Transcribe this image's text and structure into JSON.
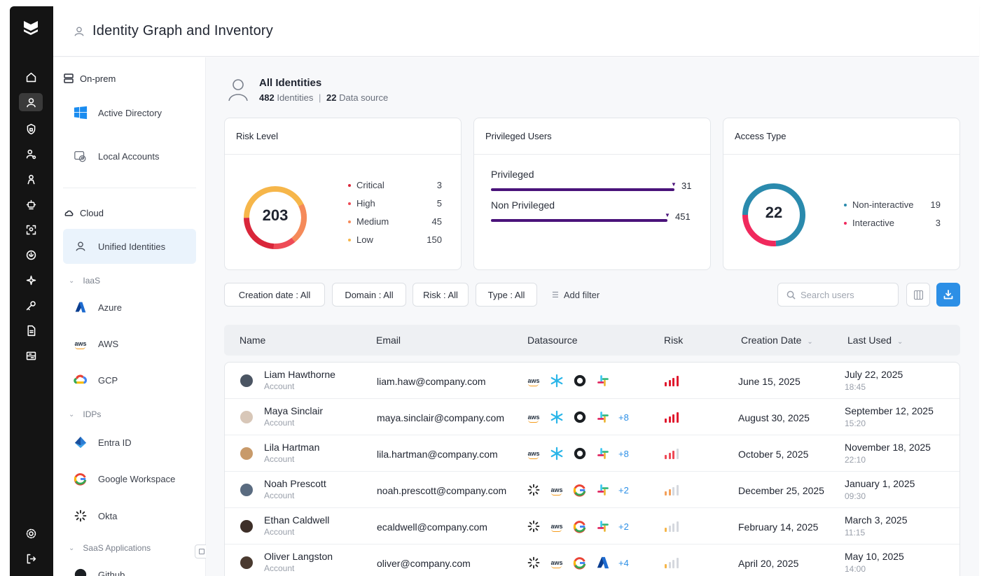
{
  "header": {
    "title": "Identity Graph and Inventory"
  },
  "sidebar": {
    "onprem_label": "On-prem",
    "onprem_items": [
      {
        "label": "Active Directory",
        "icon": "windows-icon"
      },
      {
        "label": "Local Accounts",
        "icon": "local-accounts-icon"
      }
    ],
    "cloud_label": "Cloud",
    "unified_label": "Unified Identities",
    "iaas_label": "IaaS",
    "iaas_items": [
      {
        "label": "Azure",
        "icon": "azure-icon"
      },
      {
        "label": "AWS",
        "icon": "aws-icon"
      },
      {
        "label": "GCP",
        "icon": "gcp-icon"
      }
    ],
    "idps_label": "IDPs",
    "idp_items": [
      {
        "label": "Entra ID",
        "icon": "entra-icon"
      },
      {
        "label": "Google Workspace",
        "icon": "google-icon"
      },
      {
        "label": "Okta",
        "icon": "okta-icon"
      }
    ],
    "saas_label": "SaaS Applications",
    "saas_items": [
      {
        "label": "Github",
        "icon": "github-icon"
      }
    ]
  },
  "summary": {
    "title": "All Identities",
    "identities_count": "482",
    "identities_label": "Identities",
    "sources_count": "22",
    "sources_label": "Data source"
  },
  "risk_card": {
    "title": "Risk Level",
    "total": "203",
    "levels": [
      {
        "label": "Critical",
        "value": "3",
        "color": "#d9263a"
      },
      {
        "label": "High",
        "value": "5",
        "color": "#ee4b57"
      },
      {
        "label": "Medium",
        "value": "45",
        "color": "#f58a5a"
      },
      {
        "label": "Low",
        "value": "150",
        "color": "#f6b64a"
      }
    ]
  },
  "priv_card": {
    "title": "Privileged Users",
    "rows": [
      {
        "label": "Privileged",
        "value": "31"
      },
      {
        "label": "Non Privileged",
        "value": "451"
      }
    ],
    "bar_color": "#4a137a"
  },
  "access_card": {
    "title": "Access Type",
    "total": "22",
    "rows": [
      {
        "label": "Non-interactive",
        "value": "19",
        "color": "#2a8aad"
      },
      {
        "label": "Interactive",
        "value": "3",
        "color": "#f0295d"
      }
    ]
  },
  "filters": {
    "creation": "Creation date : All",
    "domain": "Domain : All",
    "risk": "Risk : All",
    "type": "Type : All",
    "add": "Add filter",
    "search_placeholder": "Search users"
  },
  "table": {
    "columns": [
      "Name",
      "Email",
      "Datasource",
      "Risk",
      "Creation Date",
      "Last Used"
    ],
    "rows": [
      {
        "name": "Liam Hawthorne",
        "type": "Account",
        "email": "liam.haw@company.com",
        "sources": [
          "aws",
          "snowflake",
          "github",
          "slack"
        ],
        "more": "",
        "risk": 4,
        "created": "June 15, 2025",
        "last_used": "July 22, 2025",
        "last_time": "18:45"
      },
      {
        "name": "Maya Sinclair",
        "type": "Account",
        "email": "maya.sinclair@company.com",
        "sources": [
          "aws",
          "snowflake",
          "github",
          "slack"
        ],
        "more": "+8",
        "risk": 4,
        "created": "August 30, 2025",
        "last_used": "September 12, 2025",
        "last_time": "15:20"
      },
      {
        "name": "Lila Hartman",
        "type": "Account",
        "email": "lila.hartman@company.com",
        "sources": [
          "aws",
          "snowflake",
          "github",
          "slack"
        ],
        "more": "+8",
        "risk": 3,
        "created": "October 5, 2025",
        "last_used": "November 18, 2025",
        "last_time": "22:10"
      },
      {
        "name": "Noah Prescott",
        "type": "Account",
        "email": "noah.prescott@company.com",
        "sources": [
          "okta",
          "aws",
          "google",
          "slack"
        ],
        "more": "+2",
        "risk": 2,
        "created": "December 25, 2025",
        "last_used": "January 1, 2025",
        "last_time": "09:30"
      },
      {
        "name": "Ethan Caldwell",
        "type": "Account",
        "email": "ecaldwell@company.com",
        "sources": [
          "okta",
          "aws",
          "google",
          "slack"
        ],
        "more": "+2",
        "risk": 1,
        "created": "February 14, 2025",
        "last_used": "March 3, 2025",
        "last_time": "11:15"
      },
      {
        "name": "Oliver Langston",
        "type": "Account",
        "email": "oliver@company.com",
        "sources": [
          "okta",
          "aws",
          "google",
          "azure"
        ],
        "more": "+4",
        "risk": 1,
        "created": "April 20, 2025",
        "last_used": "May 10, 2025",
        "last_time": "14:00"
      }
    ]
  },
  "colors": {
    "accent": "#2c8fe6",
    "rail": "#141414",
    "risk_high": "#e0192e",
    "risk_low": "#f6b64a"
  }
}
